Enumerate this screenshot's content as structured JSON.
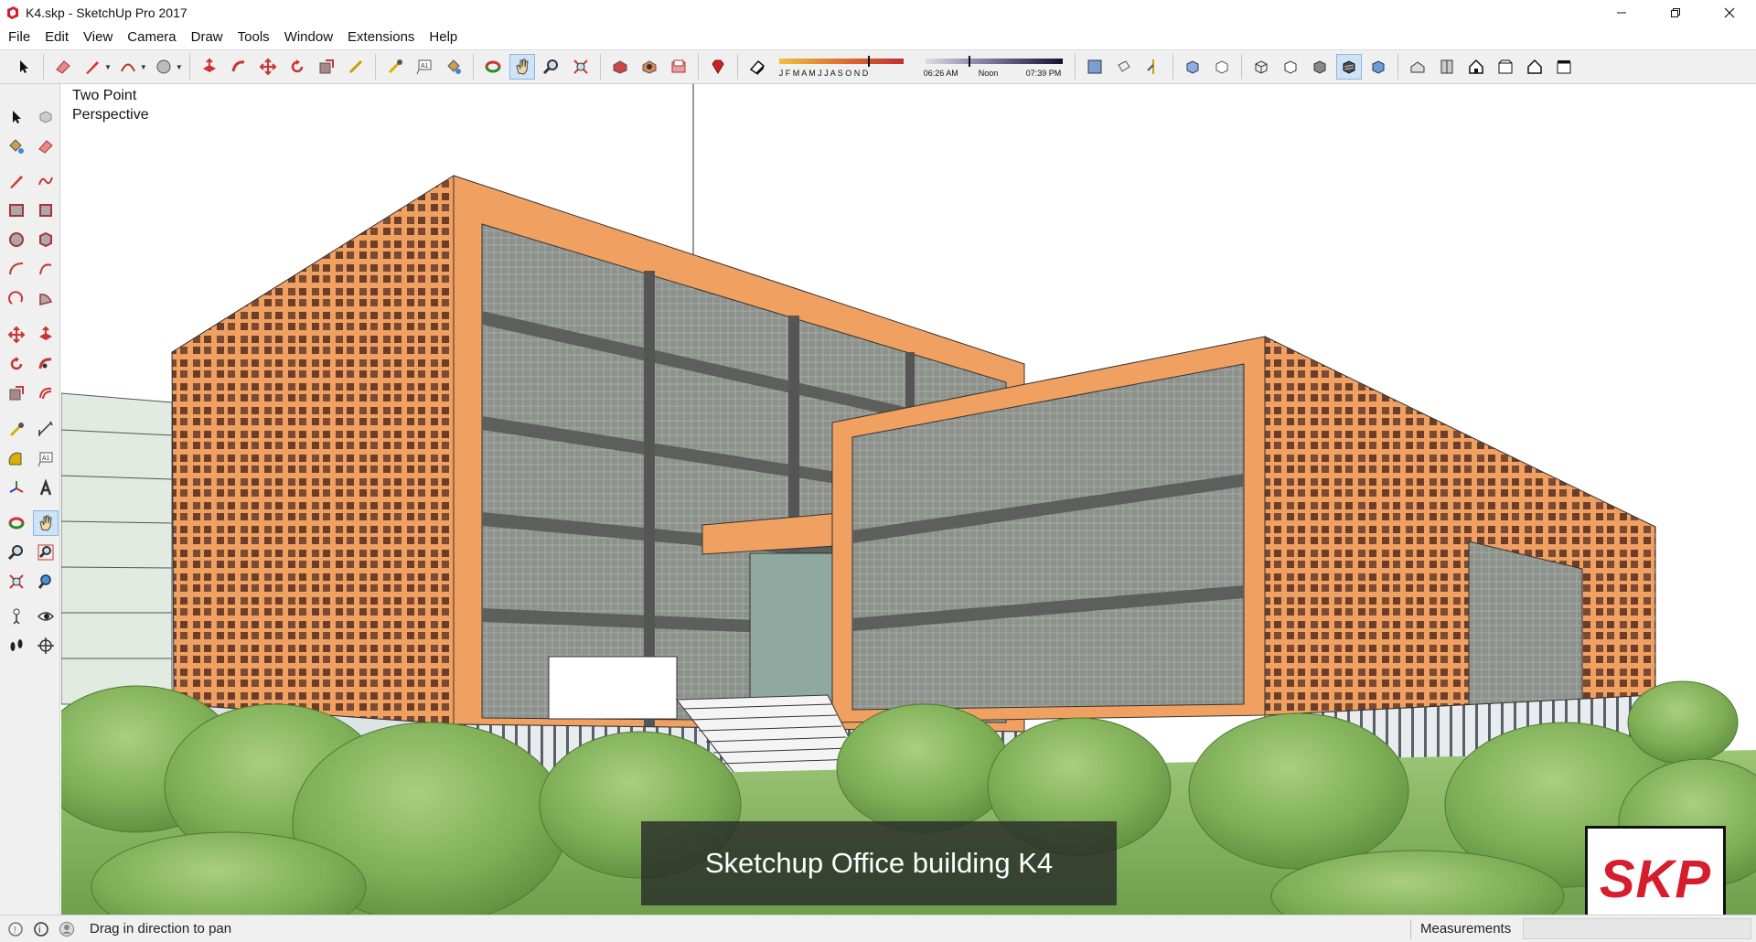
{
  "window": {
    "title": "K4.skp - SketchUp Pro 2017"
  },
  "menu": [
    "File",
    "Edit",
    "View",
    "Camera",
    "Draw",
    "Tools",
    "Window",
    "Extensions",
    "Help"
  ],
  "shadow_widget": {
    "months": "J F M A M J J A S O N D",
    "time_start": "06:26 AM",
    "time_mid": "Noon",
    "time_end": "07:39 PM"
  },
  "viewport": {
    "scene_label": "Two Point\nPerspective",
    "caption": "Sketchup Office building K4",
    "logo": "SKP"
  },
  "status": {
    "message": "Drag in direction to pan",
    "measurements_label": "Measurements",
    "measurements_value": ""
  },
  "colors": {
    "facade_orange": "#f0a060",
    "glass_gray": "#8a8f8a",
    "tree_green": "#7eae56",
    "active_tool": "#cfe3f7",
    "logo_red": "#d51d2b"
  }
}
